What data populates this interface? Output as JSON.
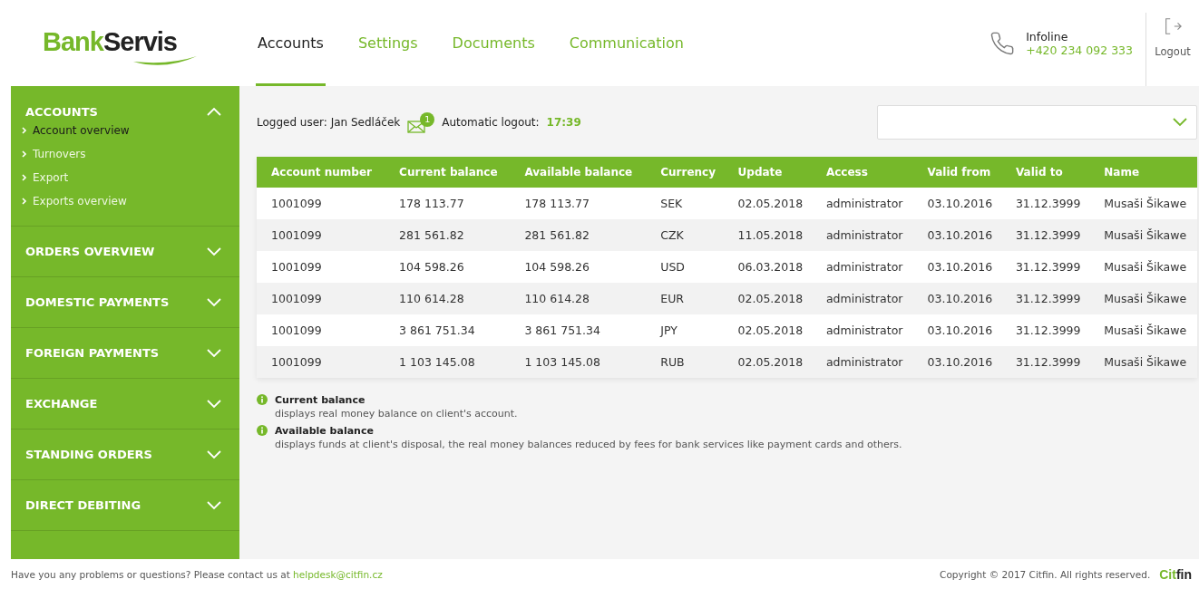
{
  "logo": {
    "part_1": "Bank",
    "part_2": "Servis"
  },
  "tabs": [
    {
      "label": "Accounts",
      "selected": true
    },
    {
      "label": "Settings",
      "selected": false
    },
    {
      "label": "Documents",
      "selected": false
    },
    {
      "label": "Communication",
      "selected": false
    }
  ],
  "infoline": {
    "label": "Infoline",
    "phone": "+420 234 092 333"
  },
  "logout": {
    "label": "Logout"
  },
  "sidebar": {
    "sections": [
      {
        "label": "ACCOUNTS",
        "expanded": true,
        "items": [
          {
            "label": "Account overview",
            "selected": true
          },
          {
            "label": "Turnovers",
            "selected": false
          },
          {
            "label": "Export",
            "selected": false
          },
          {
            "label": "Exports overview",
            "selected": false
          }
        ]
      },
      {
        "label": "ORDERS OVERVIEW",
        "expanded": false
      },
      {
        "label": "DOMESTIC PAYMENTS",
        "expanded": false
      },
      {
        "label": "FOREIGN PAYMENTS",
        "expanded": false
      },
      {
        "label": "EXCHANGE",
        "expanded": false
      },
      {
        "label": "STANDING ORDERS",
        "expanded": false
      },
      {
        "label": "DIRECT DEBITING",
        "expanded": false
      }
    ]
  },
  "user_bar": {
    "user_label": "Logged user: Jan Sedláček",
    "message_count": "1",
    "logout_label": "Automatic logout:",
    "logout_time": "17:39"
  },
  "table": {
    "columns": [
      "Account number",
      "Current balance",
      "Available balance",
      "Currency",
      "Update",
      "Access",
      "Valid from",
      "Valid to",
      "Name"
    ],
    "rows": [
      [
        "1001099",
        "178 113.77",
        "178 113.77",
        "SEK",
        "02.05.2018",
        "administrator",
        "03.10.2016",
        "31.12.3999",
        "Musaši Šikawe"
      ],
      [
        "1001099",
        "281 561.82",
        "281 561.82",
        "CZK",
        "11.05.2018",
        "administrator",
        "03.10.2016",
        "31.12.3999",
        "Musaši Šikawe"
      ],
      [
        "1001099",
        "104 598.26",
        "104 598.26",
        "USD",
        "06.03.2018",
        "administrator",
        "03.10.2016",
        "31.12.3999",
        "Musaši Šikawe"
      ],
      [
        "1001099",
        "110 614.28",
        "110 614.28",
        "EUR",
        "02.05.2018",
        "administrator",
        "03.10.2016",
        "31.12.3999",
        "Musaši Šikawe"
      ],
      [
        "1001099",
        "3 861 751.34",
        "3 861 751.34",
        "JPY",
        "02.05.2018",
        "administrator",
        "03.10.2016",
        "31.12.3999",
        "Musaši Šikawe"
      ],
      [
        "1001099",
        "1 103 145.08",
        "1 103 145.08",
        "RUB",
        "02.05.2018",
        "administrator",
        "03.10.2016",
        "31.12.3999",
        "Musaši Šikawe"
      ]
    ]
  },
  "notes": [
    {
      "title": "Current balance",
      "text": "displays real money balance on client's account."
    },
    {
      "title": "Available balance",
      "text": "displays funds at client's disposal, the real money balances reduced by fees for bank services like payment cards and others."
    }
  ],
  "footer": {
    "text": "Have you any problems or questions? Please contact us at",
    "email": "helpdesk@citfin.cz",
    "copyright": "Copyright © 2017 Citfin. All rights reserved.",
    "logo_part_1": "Cit",
    "logo_part_2": "fin"
  }
}
